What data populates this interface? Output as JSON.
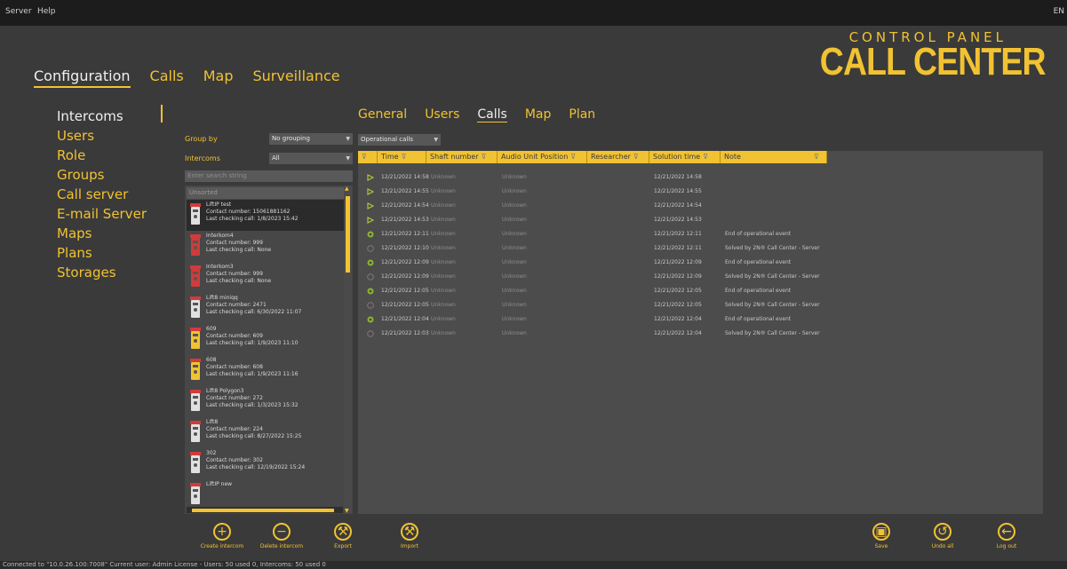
{
  "menubar": {
    "items": [
      "Server",
      "Help"
    ],
    "corner": "EN"
  },
  "main_nav": [
    "Configuration",
    "Calls",
    "Map",
    "Surveillance"
  ],
  "logo": {
    "line1": "CONTROL PANEL",
    "line2": "CALL CENTER"
  },
  "sidebar": [
    "Intercoms",
    "Users",
    "Role",
    "Groups",
    "Call server",
    "E-mail Server",
    "Maps",
    "Plans",
    "Storages"
  ],
  "filters": {
    "group_by_label": "Group by",
    "group_by_value": "No grouping",
    "intercoms_label": "Intercoms",
    "intercoms_value": "All",
    "search_placeholder": "Enter search string",
    "calls_filter": "Operational calls"
  },
  "intercom_list": {
    "unsorted_label": "Unsorted",
    "items": [
      {
        "name": "LiftIP test",
        "contact": "Contact number:  15061881162",
        "last": "Last checking call: 1/8/2023 15:42",
        "icon": "intercom-white-icon"
      },
      {
        "name": "Interkom4",
        "contact": "Contact number:  999",
        "last": "Last checking call: None",
        "icon": "intercom-red-icon"
      },
      {
        "name": "Interkom3",
        "contact": "Contact number:  999",
        "last": "Last checking call: None",
        "icon": "intercom-red-icon"
      },
      {
        "name": "Lift8 miniqq",
        "contact": "Contact number:  2471",
        "last": "Last checking call: 6/30/2022 11:07",
        "icon": "intercom-white-icon"
      },
      {
        "name": "609",
        "contact": "Contact number:  609",
        "last": "Last checking call: 1/9/2023 11:10",
        "icon": "intercom-yellow-icon"
      },
      {
        "name": "608",
        "contact": "Contact number:  608",
        "last": "Last checking call: 1/9/2023 11:16",
        "icon": "intercom-yellow-icon"
      },
      {
        "name": "Lift8 Polygon3",
        "contact": "Contact number:  272",
        "last": "Last checking call: 1/3/2023 15:32",
        "icon": "intercom-white-icon"
      },
      {
        "name": "Lift8",
        "contact": "Contact number:  224",
        "last": "Last checking call: 8/27/2022 15:25",
        "icon": "intercom-white-icon"
      },
      {
        "name": "302",
        "contact": "Contact number:  302",
        "last": "Last checking call: 12/19/2022 15:24",
        "icon": "intercom-white-icon"
      },
      {
        "name": "LiftIP new",
        "contact": "",
        "last": "",
        "icon": "intercom-white-icon"
      }
    ]
  },
  "tabs": [
    "General",
    "Users",
    "Calls",
    "Map",
    "Plan"
  ],
  "table": {
    "headers": [
      "Time",
      "Shaft number",
      "Audio Unit Position",
      "Researcher",
      "Solution time",
      "Note"
    ],
    "rows": [
      {
        "icon": "incoming-call-icon",
        "time": "12/21/2022 14:58",
        "shaft": "Unknown",
        "audio": "Unknown",
        "researcher": "",
        "solution": "12/21/2022 14:58",
        "note": ""
      },
      {
        "icon": "incoming-call-icon",
        "time": "12/21/2022 14:55",
        "shaft": "Unknown",
        "audio": "Unknown",
        "researcher": "",
        "solution": "12/21/2022 14:55",
        "note": ""
      },
      {
        "icon": "incoming-call-icon",
        "time": "12/21/2022 14:54",
        "shaft": "Unknown",
        "audio": "Unknown",
        "researcher": "",
        "solution": "12/21/2022 14:54",
        "note": ""
      },
      {
        "icon": "incoming-call-icon",
        "time": "12/21/2022 14:53",
        "shaft": "Unknown",
        "audio": "Unknown",
        "researcher": "",
        "solution": "12/21/2022 14:53",
        "note": ""
      },
      {
        "icon": "event-end-icon",
        "time": "12/21/2022 12:11",
        "shaft": "Unknown",
        "audio": "Unknown",
        "researcher": "",
        "solution": "12/21/2022 12:11",
        "note": "End of operational event"
      },
      {
        "icon": "solved-icon",
        "time": "12/21/2022 12:10",
        "shaft": "Unknown",
        "audio": "Unknown",
        "researcher": "",
        "solution": "12/21/2022 12:11",
        "note": "Solved by 2N® Call Center - Server"
      },
      {
        "icon": "event-end-icon",
        "time": "12/21/2022 12:09",
        "shaft": "Unknown",
        "audio": "Unknown",
        "researcher": "",
        "solution": "12/21/2022 12:09",
        "note": "End of operational event"
      },
      {
        "icon": "solved-icon",
        "time": "12/21/2022 12:09",
        "shaft": "Unknown",
        "audio": "Unknown",
        "researcher": "",
        "solution": "12/21/2022 12:09",
        "note": "Solved by 2N® Call Center - Server"
      },
      {
        "icon": "event-end-icon",
        "time": "12/21/2022 12:05",
        "shaft": "Unknown",
        "audio": "Unknown",
        "researcher": "",
        "solution": "12/21/2022 12:05",
        "note": "End of operational event"
      },
      {
        "icon": "solved-icon",
        "time": "12/21/2022 12:05",
        "shaft": "Unknown",
        "audio": "Unknown",
        "researcher": "",
        "solution": "12/21/2022 12:05",
        "note": "Solved by 2N® Call Center - Server"
      },
      {
        "icon": "event-end-icon",
        "time": "12/21/2022 12:04",
        "shaft": "Unknown",
        "audio": "Unknown",
        "researcher": "",
        "solution": "12/21/2022 12:04",
        "note": "End of operational event"
      },
      {
        "icon": "solved-icon",
        "time": "12/21/2022 12:03",
        "shaft": "Unknown",
        "audio": "Unknown",
        "researcher": "",
        "solution": "12/21/2022 12:04",
        "note": "Solved by 2N® Call Center - Server"
      }
    ]
  },
  "buttons_left": [
    {
      "label": "Create intercom",
      "icon": "plus-icon"
    },
    {
      "label": "Delete intercom",
      "icon": "minus-icon"
    },
    {
      "label": "Export",
      "icon": "wrench-icon"
    },
    {
      "label": "Import",
      "icon": "wrench-icon"
    }
  ],
  "buttons_right": [
    {
      "label": "Save",
      "icon": "save-icon"
    },
    {
      "label": "Undo all",
      "icon": "undo-icon"
    },
    {
      "label": "Log out",
      "icon": "logout-icon"
    }
  ],
  "status": "Connected to \"10.0.26.100:7008\"  Current user: Admin    License - Users: 50 used 0, Intercoms: 50 used 0",
  "colors": {
    "accent": "#f1c232",
    "background": "#3a3a3a",
    "panel": "#4c4c4c"
  }
}
